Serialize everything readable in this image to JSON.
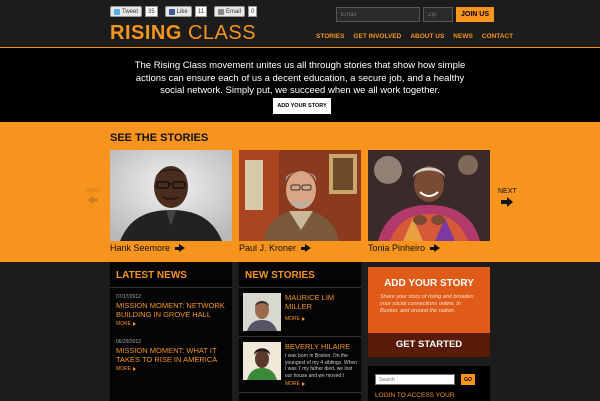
{
  "header": {
    "social": {
      "tweet_label": "Tweet",
      "tweet_count": "35",
      "like_label": "Like",
      "like_count": "11",
      "email_label": "Email",
      "email_count": "0"
    },
    "logo_bold": "RISING",
    "logo_thin": "CLASS",
    "signup": {
      "email_placeholder": "Email",
      "zip_placeholder": "Zip",
      "join_label": "JOIN US"
    },
    "nav": [
      "STORIES",
      "GET INVOLVED",
      "ABOUT US",
      "NEWS",
      "CONTACT"
    ]
  },
  "intro": {
    "text": "The Rising Class movement unites us all through stories that show how simple actions can ensure each of us a decent education, a secure job, and a healthy social network. Simply put, we succeed when we all work together.",
    "button": "ADD YOUR STORY"
  },
  "stories": {
    "heading": "SEE THE STORIES",
    "prev_label": "PREV",
    "next_label": "NEXT",
    "items": [
      {
        "name": "Hank Seemore"
      },
      {
        "name": "Paul J. Kroner"
      },
      {
        "name": "Tonia Pinheiro"
      }
    ]
  },
  "latest_news": {
    "heading": "LATEST NEWS",
    "items": [
      {
        "date": "07/17/2012",
        "title": "MISSION MOMENT: NETWORK BUILDING IN GROVE HALL",
        "more": "MORE"
      },
      {
        "date": "06/29/2012",
        "title": "MISSION MOMENT: WHAT IT TAKES TO RISE IN AMERICA",
        "more": "MORE"
      }
    ]
  },
  "new_stories": {
    "heading": "NEW STORIES",
    "items": [
      {
        "name": "MAURICE LIM MILLER",
        "desc": "",
        "more": "MORE"
      },
      {
        "name": "BEVERLY HILAIRE",
        "desc": "I was born in Boston. I'm the youngest of my 4 siblings. When I was 7 my father died, we lost our house and we moved t",
        "more": "MORE"
      }
    ]
  },
  "add_story": {
    "heading": "ADD YOUR STORY",
    "text": "Share your story of rising and broaden your social connections online, in Boston, and around the nation.",
    "cta": "GET STARTED"
  },
  "sidebar_search": {
    "placeholder": "Search",
    "go_label": "GO",
    "login_text": "LOGIN TO ACCESS YOUR"
  },
  "colors": {
    "accent": "#f7941d",
    "add_story_bg": "#e05a18",
    "cta_bg": "#5a1a08"
  }
}
